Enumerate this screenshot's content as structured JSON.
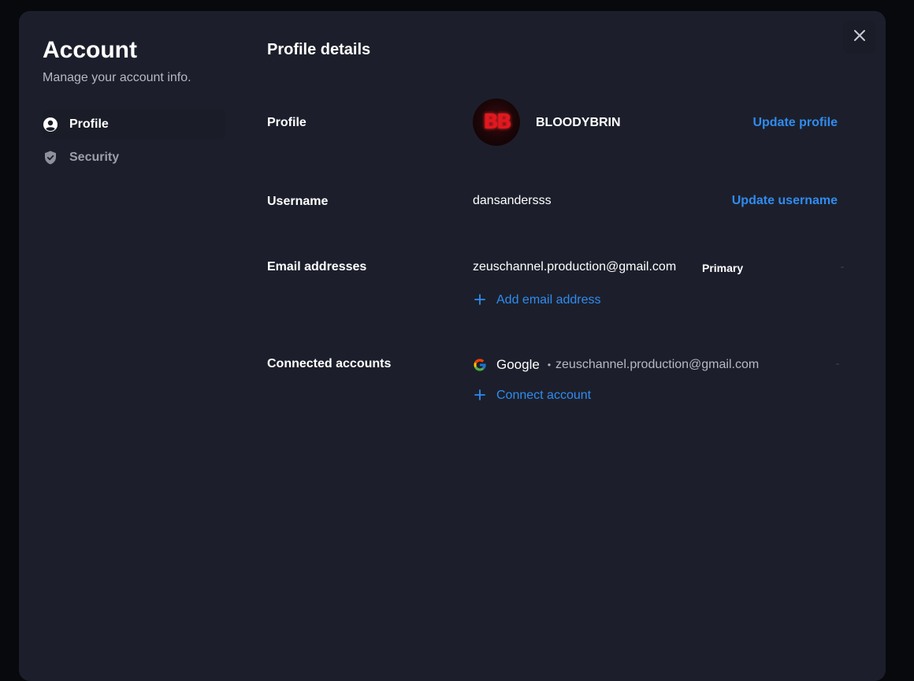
{
  "sidebar": {
    "title": "Account",
    "subtitle": "Manage your account info.",
    "items": [
      {
        "label": "Profile",
        "icon": "user-circle-icon",
        "active": true
      },
      {
        "label": "Security",
        "icon": "shield-check-icon",
        "active": false
      }
    ]
  },
  "main": {
    "title": "Profile details",
    "profile": {
      "label": "Profile",
      "avatar_initials": "BB",
      "name": "BLOODYBRIN",
      "action": "Update profile"
    },
    "username": {
      "label": "Username",
      "value": "dansandersss",
      "action": "Update username"
    },
    "email": {
      "label": "Email addresses",
      "value": "zeuschannel.production@gmail.com",
      "badge": "Primary",
      "add_action": "Add email address"
    },
    "connected": {
      "label": "Connected accounts",
      "provider": "Google",
      "separator": "•",
      "account_email": "zeuschannel.production@gmail.com",
      "add_action": "Connect account"
    }
  },
  "colors": {
    "accent": "#2f8cf0",
    "panel": "#1c1f2b",
    "backdrop": "#08090c"
  }
}
